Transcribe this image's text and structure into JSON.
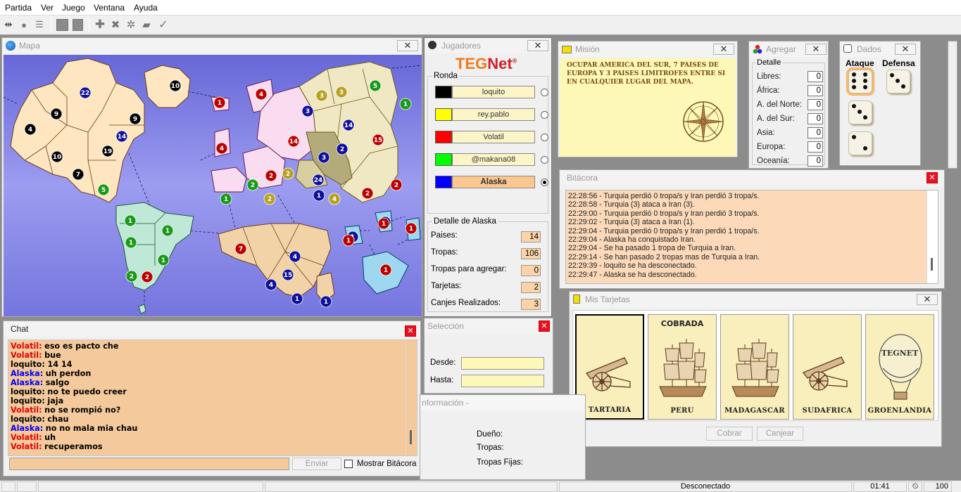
{
  "menu": [
    "Partida",
    "Ver",
    "Juego",
    "Ventana",
    "Ayuda"
  ],
  "toolbar": {
    "icons": [
      "connect-icon",
      "disconnect-icon",
      "list-icon",
      "stop-icon",
      "pause-icon",
      "add-icon",
      "cross-icon",
      "settings-icon",
      "cards-icon",
      "check-icon"
    ]
  },
  "map": {
    "title": "Mapa",
    "armies": [
      {
        "n": "22",
        "c": "#10109a"
      },
      {
        "n": "10",
        "c": "#000"
      },
      {
        "n": "9",
        "c": "#000"
      },
      {
        "n": "9",
        "c": "#000"
      },
      {
        "n": "4",
        "c": "#000"
      },
      {
        "n": "14",
        "c": "#10109a"
      },
      {
        "n": "19",
        "c": "#000"
      },
      {
        "n": "10",
        "c": "#000"
      },
      {
        "n": "7",
        "c": "#000"
      },
      {
        "n": "5",
        "c": "#1a9a1a"
      },
      {
        "n": "1",
        "c": "#b00"
      },
      {
        "n": "4",
        "c": "#b00"
      },
      {
        "n": "4",
        "c": "#b00"
      },
      {
        "n": "3",
        "c": "#10109a"
      },
      {
        "n": "14",
        "c": "#b00"
      },
      {
        "n": "3",
        "c": "#b8a020"
      },
      {
        "n": "3",
        "c": "#b8a020"
      },
      {
        "n": "5",
        "c": "#1a9a1a"
      },
      {
        "n": "1",
        "c": "#1a9a1a"
      },
      {
        "n": "14",
        "c": "#10109a"
      },
      {
        "n": "15",
        "c": "#b00"
      },
      {
        "n": "2",
        "c": "#10109a"
      },
      {
        "n": "3",
        "c": "#10109a"
      },
      {
        "n": "2",
        "c": "#b00"
      },
      {
        "n": "2",
        "c": "#b8a020"
      },
      {
        "n": "2",
        "c": "#1a9a1a"
      },
      {
        "n": "1",
        "c": "#1a9a1a"
      },
      {
        "n": "2",
        "c": "#b8a020"
      },
      {
        "n": "24",
        "c": "#10109a"
      },
      {
        "n": "1",
        "c": "#10109a"
      },
      {
        "n": "4",
        "c": "#b8a020"
      },
      {
        "n": "2",
        "c": "#b00"
      },
      {
        "n": "2",
        "c": "#b00"
      },
      {
        "n": "1",
        "c": "#1a9a1a"
      },
      {
        "n": "1",
        "c": "#1a9a1a"
      },
      {
        "n": "1",
        "c": "#1a9a1a"
      },
      {
        "n": "1",
        "c": "#1a9a1a"
      },
      {
        "n": "2",
        "c": "#1a9a1a"
      },
      {
        "n": "2",
        "c": "#b00"
      },
      {
        "n": "7",
        "c": "#b00"
      },
      {
        "n": "4",
        "c": "#10109a"
      },
      {
        "n": "15",
        "c": "#10109a"
      },
      {
        "n": "4",
        "c": "#10109a"
      },
      {
        "n": "1",
        "c": "#10109a"
      },
      {
        "n": "1",
        "c": "#10109a"
      },
      {
        "n": "1",
        "c": "#10109a"
      },
      {
        "n": "1",
        "c": "#10109a"
      },
      {
        "n": "1",
        "c": "#b00"
      },
      {
        "n": "1",
        "c": "#b00"
      },
      {
        "n": "1",
        "c": "#b00"
      },
      {
        "n": "1",
        "c": "#b00"
      }
    ]
  },
  "players": {
    "title": "Jugadores",
    "logo_a": "TEG",
    "logo_b": "Net",
    "round_label": "Ronda",
    "list": [
      {
        "name": "loquito",
        "color": "#000000",
        "active": false
      },
      {
        "name": "rey.pablo",
        "color": "#ffff00",
        "active": false
      },
      {
        "name": "Volatil",
        "color": "#ff0000",
        "active": false
      },
      {
        "name": "@makana08",
        "color": "#00ff00",
        "active": false
      },
      {
        "name": "Alaska",
        "color": "#0000ff",
        "active": true
      }
    ],
    "detail_title": "Detalle de Alaska",
    "detail": [
      {
        "label": "Paises:",
        "value": "14"
      },
      {
        "label": "Tropas:",
        "value": "106"
      },
      {
        "label": "Tropas para agregar:",
        "value": "0"
      },
      {
        "label": "Tarjetas:",
        "value": "2"
      },
      {
        "label": "Canjes Realizados:",
        "value": "3"
      }
    ]
  },
  "mission": {
    "title": "Misión",
    "text": "OCUPAR AMERICA DEL SUR, 7 PAISES DE EUROPA Y 3 PAISES LIMITROFES ENTRE SI EN CUALQUIER LUGAR DEL MAPA."
  },
  "add": {
    "title": "Agregar",
    "detail_label": "Detalle",
    "rows": [
      {
        "label": "Libres:",
        "value": "0"
      },
      {
        "label": "África:",
        "value": "0"
      },
      {
        "label": "A. del Norte:",
        "value": "0"
      },
      {
        "label": "A. del Sur:",
        "value": "0"
      },
      {
        "label": "Asia:",
        "value": "0"
      },
      {
        "label": "Europa:",
        "value": "0"
      },
      {
        "label": "Oceanía:",
        "value": "0"
      }
    ]
  },
  "dice": {
    "title": "Dados",
    "attack_label": "Ataque",
    "defense_label": "Defensa",
    "attack": [
      6,
      3,
      2
    ],
    "defense": [
      3
    ]
  },
  "log": {
    "title": "Bitácora",
    "lines": [
      "22:28:56 - Turquia perdió 0 tropa/s y Iran perdió 3 tropa/s.",
      "22:28:58 - Turquia (3) ataca a Iran (3).",
      "22:29:00 - Turquia perdió 0 tropa/s y Iran perdió 3 tropa/s.",
      "22:29:02 - Turquia (3) ataca a Iran (1).",
      "22:29:04 - Turquia perdió 0 tropa/s y Iran perdió 1 tropa/s.",
      "22:29:04 - Alaska ha conquistado Iran.",
      "22:29:04 - Se ha pasado 1 tropa de Turquia a Iran.",
      "22:29:14 - Se han pasado 2 tropas mas de Turquia a Iran.",
      "22:29:39 - loquito se ha desconectado.",
      "22:29:47 - Alaska se ha desconectado."
    ]
  },
  "cards": {
    "title": "Mis Tarjetas",
    "items": [
      {
        "name": "TARTARIA",
        "type": "cannon",
        "top": "",
        "selected": true
      },
      {
        "name": "PERU",
        "type": "ship",
        "top": "COBRADA",
        "selected": false
      },
      {
        "name": "MADAGASCAR",
        "type": "ship",
        "top": "",
        "selected": false
      },
      {
        "name": "SUDAFRICA",
        "type": "cannon",
        "top": "",
        "selected": false
      },
      {
        "name": "GROENLANDIA",
        "type": "balloon",
        "top": "",
        "selected": false
      }
    ],
    "collect_label": "Cobrar",
    "exchange_label": "Canjear",
    "balloon_text": "TEGNET"
  },
  "chat": {
    "title": "Chat",
    "messages": [
      {
        "user": "Volatil:",
        "color": "#e00000",
        "text": "eso es pacto che"
      },
      {
        "user": "Volatil:",
        "color": "#e00000",
        "text": "bue"
      },
      {
        "user": "loquito:",
        "color": "#000000",
        "text": "14 14"
      },
      {
        "user": "Alaska:",
        "color": "#0000ee",
        "text": "uh perdon"
      },
      {
        "user": "Alaska:",
        "color": "#0000ee",
        "text": "salgo"
      },
      {
        "user": "loquito:",
        "color": "#000000",
        "text": "no te puedo creer"
      },
      {
        "user": "loquito:",
        "color": "#000000",
        "text": "jaja"
      },
      {
        "user": "Volatil:",
        "color": "#e00000",
        "text": "no se rompió no?"
      },
      {
        "user": "loquito:",
        "color": "#000000",
        "text": "chau"
      },
      {
        "user": "Alaska:",
        "color": "#0000ee",
        "text": "no no mala mia chau"
      },
      {
        "user": "Volatil:",
        "color": "#e00000",
        "text": "uh"
      },
      {
        "user": "Volatil:",
        "color": "#e00000",
        "text": "recuperamos"
      }
    ],
    "input_value": "",
    "send_label": "Enviar",
    "show_log_label": "Mostrar Bitácora"
  },
  "selection": {
    "title": "Selección",
    "from_label": "Desde:",
    "to_label": "Hasta:",
    "from_value": "",
    "to_value": ""
  },
  "info": {
    "title": "nformación -",
    "owner_label": "Dueño:",
    "troops_label": "Tropas:",
    "fixed_troops_label": "Tropas Fijas:"
  },
  "status": {
    "connection": "Desconectado",
    "time": "01:41",
    "value": "100"
  }
}
